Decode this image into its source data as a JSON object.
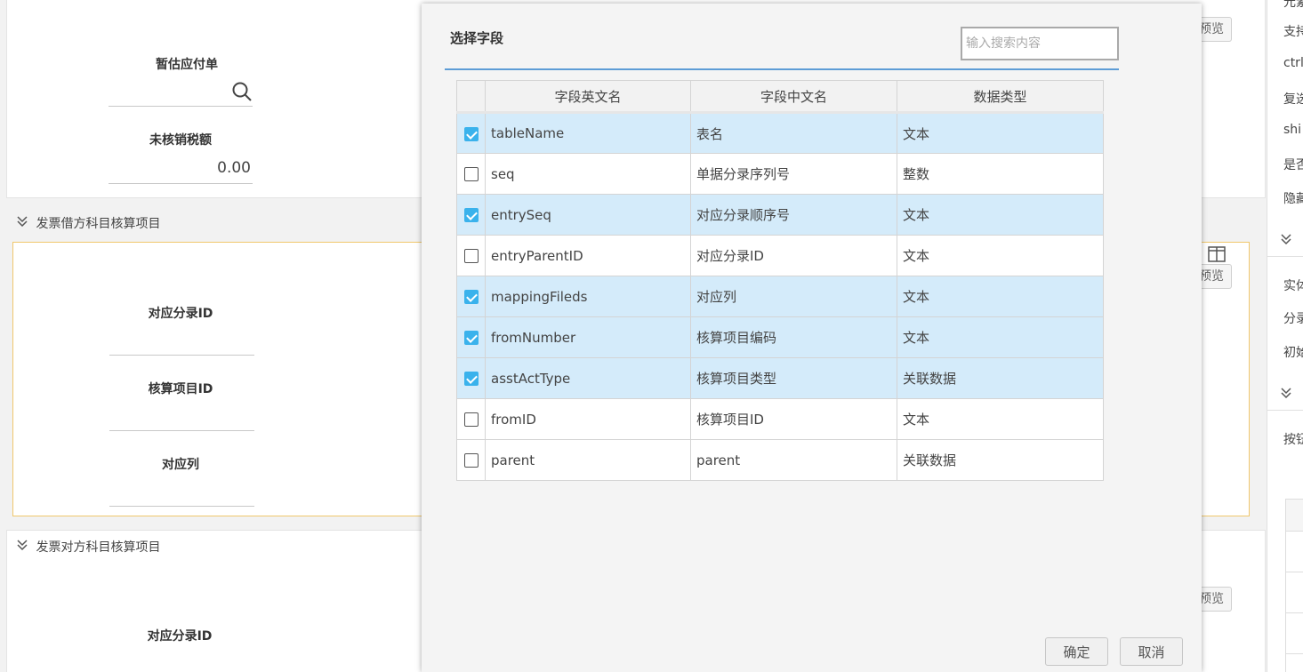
{
  "background": {
    "form1": {
      "field1_label": "暂估应付单",
      "field2_label": "未核销税额",
      "field2_value": "0.00"
    },
    "section1": {
      "title": "发票借方科目核算项目",
      "fields": [
        "对应分录ID",
        "核算项目ID",
        "对应列"
      ]
    },
    "section2": {
      "title": "发票对方科目核算项目",
      "fields": [
        "对应分录ID"
      ]
    },
    "preview_label": "预览",
    "right_panel": {
      "items": [
        "元素",
        "支持",
        "ctrl",
        "复选",
        "shi",
        "是否",
        "隐藏",
        "实体",
        "分录",
        "初始",
        "按钮"
      ]
    }
  },
  "dialog": {
    "title": "选择字段",
    "search_placeholder": "输入搜索内容",
    "columns": [
      "字段英文名",
      "字段中文名",
      "数据类型"
    ],
    "rows": [
      {
        "checked": true,
        "en": "tableName",
        "cn": "表名",
        "type": "文本"
      },
      {
        "checked": false,
        "en": "seq",
        "cn": "单据分录序列号",
        "type": "整数"
      },
      {
        "checked": true,
        "en": "entrySeq",
        "cn": "对应分录顺序号",
        "type": "文本"
      },
      {
        "checked": false,
        "en": "entryParentID",
        "cn": "对应分录ID",
        "type": "文本"
      },
      {
        "checked": true,
        "en": "mappingFileds",
        "cn": "对应列",
        "type": "文本"
      },
      {
        "checked": true,
        "en": "fromNumber",
        "cn": "核算项目编码",
        "type": "文本"
      },
      {
        "checked": true,
        "en": "asstActType",
        "cn": "核算项目类型",
        "type": "关联数据"
      },
      {
        "checked": false,
        "en": "fromID",
        "cn": "核算项目ID",
        "type": "文本"
      },
      {
        "checked": false,
        "en": "parent",
        "cn": "parent",
        "type": "关联数据"
      }
    ],
    "confirm_label": "确定",
    "cancel_label": "取消"
  },
  "colors": {
    "accent": "#3ab2ec",
    "selected_row": "#d4ebfa",
    "title_rule": "#5d9cd6",
    "section_border": "#f0c76c"
  }
}
